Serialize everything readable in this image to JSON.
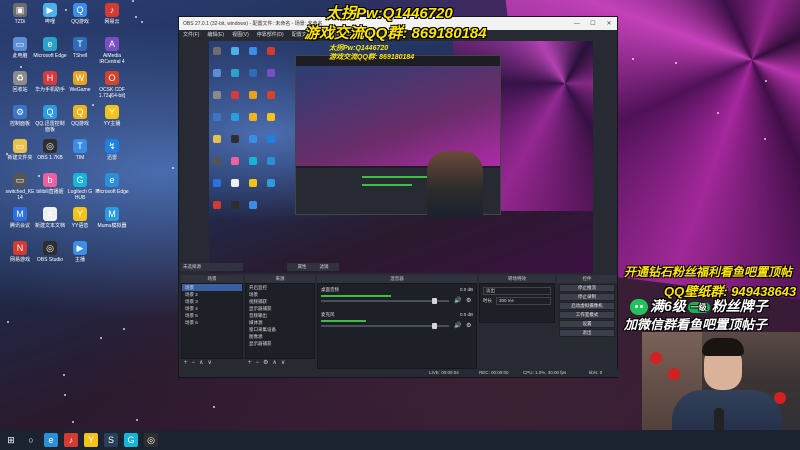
{
  "desktop_icons": [
    {
      "label": "TZDi",
      "color": "#6d6d6d",
      "glyph": "▣"
    },
    {
      "label": "哔哩",
      "color": "#4db0e8",
      "glyph": "▶"
    },
    {
      "label": "QQ游戏",
      "color": "#3a8ee6",
      "glyph": "Q"
    },
    {
      "label": "网易云",
      "color": "#d33a31",
      "glyph": "♪"
    },
    {
      "label": "此电脑",
      "color": "#5a8fd6",
      "glyph": "▭"
    },
    {
      "label": "Microsoft Edge",
      "color": "#2aa3c9",
      "glyph": "e"
    },
    {
      "label": "TShell",
      "color": "#2f6bb8",
      "glyph": "T"
    },
    {
      "label": "AiMedia IRCentral 4",
      "color": "#7a4fc4",
      "glyph": "A"
    },
    {
      "label": "回收站",
      "color": "#8b8b8b",
      "glyph": "♻"
    },
    {
      "label": "华为手机助手",
      "color": "#d63b3b",
      "glyph": "H"
    },
    {
      "label": "WeGame",
      "color": "#e7a319",
      "glyph": "W"
    },
    {
      "label": "OCSK CDF 1.73 [64-bit]",
      "color": "#d6422a",
      "glyph": "O"
    },
    {
      "label": "控制面板",
      "color": "#3a76c5",
      "glyph": "⚙"
    },
    {
      "label": "QQ.迅雷控制面板",
      "color": "#2b9ce0",
      "glyph": "Q"
    },
    {
      "label": "QQ游戏",
      "color": "#f1b31c",
      "glyph": "Q"
    },
    {
      "label": "YY主播",
      "color": "#f5c218",
      "glyph": "Y"
    },
    {
      "label": "新建文件夹",
      "color": "#e8c04a",
      "glyph": "▭"
    },
    {
      "label": "OBS 1.7KB",
      "color": "#2e2e2e",
      "glyph": "◎"
    },
    {
      "label": "TIM",
      "color": "#3a8ee6",
      "glyph": "T"
    },
    {
      "label": "迅雷",
      "color": "#1f7fe0",
      "glyph": "↯"
    },
    {
      "label": "switched_KE 14",
      "color": "#555555",
      "glyph": "▭"
    },
    {
      "label": "bilibili直播姬",
      "color": "#f060a0",
      "glyph": "b"
    },
    {
      "label": "Logitech G HUB",
      "color": "#16b4d9",
      "glyph": "G"
    },
    {
      "label": "Microsoft Edge",
      "color": "#2a8fd6",
      "glyph": "e"
    },
    {
      "label": "腾讯会议",
      "color": "#2d6fe4",
      "glyph": "M"
    },
    {
      "label": "新建文本文档",
      "color": "#f0f0f0",
      "glyph": "≡"
    },
    {
      "label": "YY语音",
      "color": "#f5c218",
      "glyph": "Y"
    },
    {
      "label": "Mumu模拟器",
      "color": "#2b9ce0",
      "glyph": "M"
    },
    {
      "label": "网易游戏",
      "color": "#d33a31",
      "glyph": "N"
    },
    {
      "label": "OBS Studio",
      "color": "#2e2e2e",
      "glyph": "◎"
    },
    {
      "label": "主播",
      "color": "#3a8ee6",
      "glyph": "▶"
    }
  ],
  "obs": {
    "title": "OBS 27.0.1 (32-bit, windows) - 配置文件: 未命名 - 场景: 未命名",
    "menu": [
      "文件(F)",
      "编辑(E)",
      "视图(V)",
      "停靠部件(D)",
      "配置文件(P)",
      "场景集合(S)",
      "工具(T)",
      "帮助(H)"
    ],
    "window_buttons": {
      "minimize": "—",
      "maximize": "☐",
      "close": "✕"
    },
    "preview_bottom_left": "未选择源",
    "preview_properties": "属性",
    "preview_filters": "滤镜",
    "docks": {
      "scenes_title": "场景",
      "scenes": [
        "场景",
        "场景 2",
        "场景 3",
        "场景 4",
        "场景 5",
        "场景 6"
      ],
      "sources_title": "来源",
      "sources": [
        "开启监控",
        "场景",
        "视频捕获",
        "显示器捕获",
        "音频输出",
        "媒体源",
        "窗口采集设备",
        "图像源",
        "显示器捕获"
      ],
      "mixer_title": "混音器",
      "mixer_tracks": [
        {
          "name": "桌面音频",
          "db": "0.0 dB",
          "level": 0.55,
          "slider": 0.9
        },
        {
          "name": "麦克风",
          "db": "0.0 dB",
          "level": 0.35,
          "slider": 0.9
        }
      ],
      "transitions_title": "转场特效",
      "transition_value": "淡出",
      "duration_label": "时长",
      "duration_value": "300 ms",
      "controls_title": "控件",
      "controls": [
        "停止推流",
        "停止录制",
        "启动虚拟摄像机",
        "工作室模式",
        "设置",
        "退出"
      ]
    },
    "status": {
      "live": "LIVE: 00:00:04",
      "rec": "REC: 00:00:00",
      "cpu": "CPU: 1.0%, 30.00 fps",
      "kbs": "kb/s: 0"
    }
  },
  "overlay": {
    "top_line1": "太拐Pw:Q1446720",
    "top_line2": "游戏交流QQ群: 869180184",
    "right_line1": "开通钻石粉丝福利看鱼吧置顶帖",
    "right_line2": "QQ壁纸群: 949438643",
    "right_line3_a": "满6级",
    "right_line3_badge": "一级",
    "right_line3_b": "粉丝牌子",
    "right_line4": "加微信群看鱼吧置顶帖子",
    "preview_line1": "太拐Pw:Q1446720",
    "preview_line2": "游戏交流QQ群: 869180184"
  },
  "taskbar": [
    {
      "name": "start",
      "glyph": "⊞",
      "color": "#1c2330"
    },
    {
      "name": "search",
      "glyph": "○",
      "color": "#1c2330"
    },
    {
      "name": "edge",
      "glyph": "e",
      "color": "#2a8fd6"
    },
    {
      "name": "netease",
      "glyph": "♪",
      "color": "#d33a31"
    },
    {
      "name": "yy",
      "glyph": "Y",
      "color": "#f5c218"
    },
    {
      "name": "steam",
      "glyph": "S",
      "color": "#2a3f5a"
    },
    {
      "name": "ghub",
      "glyph": "G",
      "color": "#16b4d9"
    },
    {
      "name": "obs",
      "glyph": "◎",
      "color": "#2e2e2e"
    }
  ],
  "colors": {
    "overlay_blue": "#37a8ff",
    "overlay_yellow": "#ffe600",
    "obs_dark": "#272a33",
    "meter_green": "#3fbf3f"
  }
}
